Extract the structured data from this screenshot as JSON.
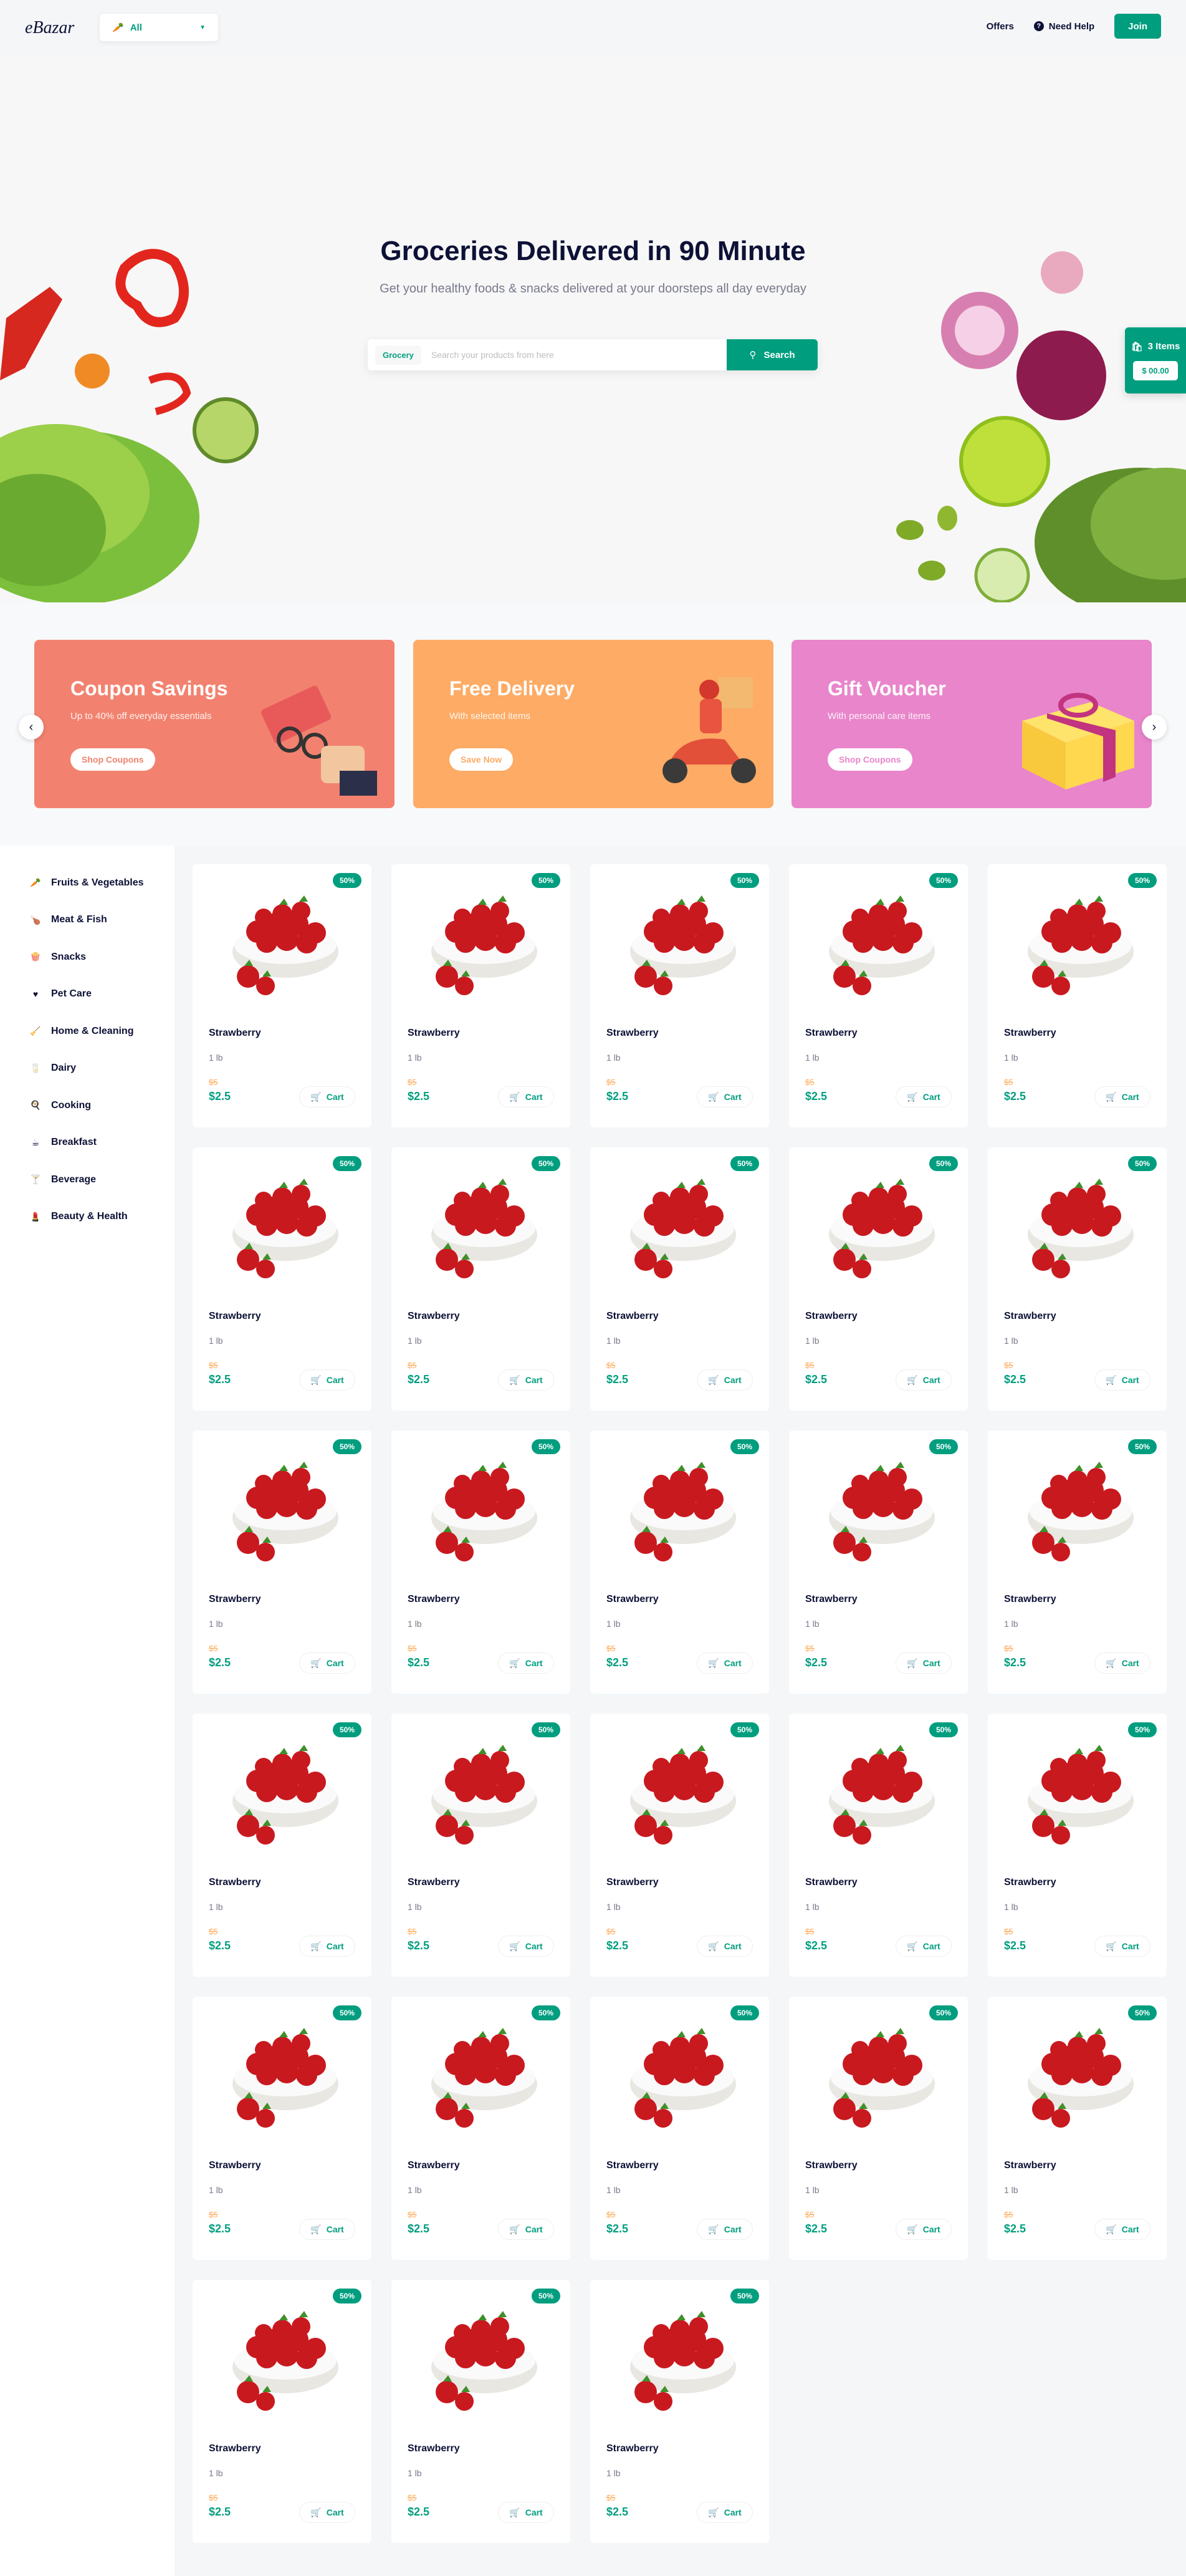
{
  "header": {
    "logo": "eBazar",
    "category_select": "All",
    "offers_label": "Offers",
    "help_label": "Need Help",
    "join_label": "Join"
  },
  "hero": {
    "title": "Groceries Delivered in 90 Minute",
    "subtitle": "Get your healthy foods & snacks delivered at your doorsteps all day everyday",
    "search_tag": "Grocery",
    "search_placeholder": "Search your products from here",
    "search_button": "Search"
  },
  "cart": {
    "items_label": "3 Items",
    "amount": "$ 00.00"
  },
  "offers": [
    {
      "title": "Coupon Savings",
      "subtitle": "Up to 40% off everyday essentials",
      "button": "Shop Coupons",
      "color": "#f2826f",
      "button_color": "#f2826f"
    },
    {
      "title": "Free Delivery",
      "subtitle": "With selected items",
      "button": "Save Now",
      "color": "#fdab65",
      "button_color": "#fdab65"
    },
    {
      "title": "Gift Voucher",
      "subtitle": "With personal care items",
      "button": "Shop Coupons",
      "color": "#e985cb",
      "button_color": "#e985cb"
    }
  ],
  "sidebar": {
    "categories": [
      {
        "label": "Fruits & Vegetables",
        "icon": "carrot-icon"
      },
      {
        "label": "Meat & Fish",
        "icon": "drumstick-icon"
      },
      {
        "label": "Snacks",
        "icon": "snack-icon"
      },
      {
        "label": "Pet Care",
        "icon": "paw-heart-icon"
      },
      {
        "label": "Home & Cleaning",
        "icon": "cleaning-icon"
      },
      {
        "label": "Dairy",
        "icon": "milk-icon"
      },
      {
        "label": "Cooking",
        "icon": "cooking-pot-icon"
      },
      {
        "label": "Breakfast",
        "icon": "breakfast-icon"
      },
      {
        "label": "Beverage",
        "icon": "cocktail-icon"
      },
      {
        "label": "Beauty & Health",
        "icon": "beauty-icon"
      }
    ]
  },
  "product": {
    "name": "Strawberry",
    "weight": "1 lb",
    "discount": "50%",
    "old_price": "$5",
    "price": "$2.5",
    "cart_label": "Cart",
    "count": 28
  },
  "colors": {
    "accent": "#009e7f",
    "sale": "#ffad5e",
    "heading": "#0d1136"
  }
}
